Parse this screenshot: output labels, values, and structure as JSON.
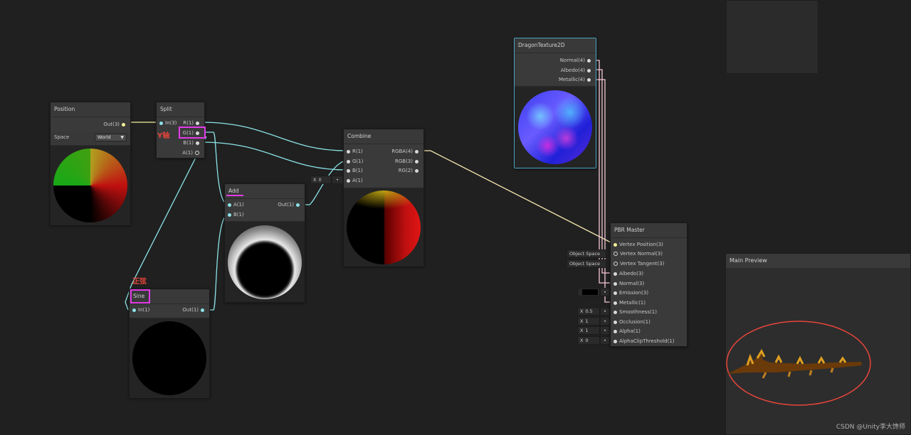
{
  "nodes": {
    "position": {
      "title": "Position",
      "out_label": "Out(3)",
      "space_label": "Space",
      "space_value": "World"
    },
    "split": {
      "title": "Split",
      "in_label": "In(3)",
      "outputs": [
        "R(1)",
        "G(1)",
        "B(1)",
        "A(1)"
      ]
    },
    "add": {
      "title": "Add",
      "inputs": [
        "A(1)",
        "B(1)"
      ],
      "out_label": "Out(1)"
    },
    "sine": {
      "title": "Sine",
      "in_label": "In(1)",
      "out_label": "Out(1)"
    },
    "combine": {
      "title": "Combine",
      "inputs": [
        "R(1)",
        "G(1)",
        "B(1)",
        "A(1)"
      ],
      "outputs": [
        "RGBA(4)",
        "RGB(3)",
        "RG(2)"
      ],
      "a_default_axis": "X",
      "a_default_value": "0"
    },
    "dragon_texture": {
      "title": "DragonTexture2D",
      "outputs": [
        "Normal(4)",
        "Albedo(4)",
        "Metallic(4)"
      ]
    },
    "pbr_master": {
      "title": "PBR Master",
      "inputs": [
        "Vertex Position(3)",
        "Vertex Normal(3)",
        "Vertex Tangent(3)",
        "Albedo(3)",
        "Normal(3)",
        "Emission(3)",
        "Metallic(1)",
        "Smoothness(1)",
        "Occlusion(1)",
        "Alpha(1)",
        "AlphaClipThreshold(1)"
      ],
      "vertex_normal_space": "Object Space",
      "vertex_tangent_space": "Object Space",
      "smoothness_axis": "X",
      "smoothness_value": "0.5",
      "occlusion_axis": "X",
      "occlusion_value": "1",
      "alpha_axis": "X",
      "alpha_value": "1",
      "alpha_clip_axis": "X",
      "alpha_clip_value": "0"
    }
  },
  "main_preview": {
    "title": "Main Preview"
  },
  "annotations": {
    "y_axis": "Y轴",
    "sine_cn": "正弦"
  },
  "watermark": "CSDN @Unity李大馋师",
  "colors": {
    "background": "#202020",
    "wire_cyan": "#8be3e7",
    "wire_yellow": "#f3ef9b",
    "wire_pink": "#f5c6d4",
    "annotation_magenta": "#e23be8",
    "annotation_red": "#e8453a",
    "texture_border": "#4aa6c4"
  }
}
